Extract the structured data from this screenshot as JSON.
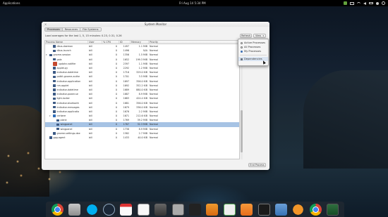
{
  "top_panel": {
    "applications_label": "Applications",
    "clock": "Fri Aug 14  5:34 PM"
  },
  "window": {
    "title": "System Monitor",
    "close_glyph": "×",
    "tabs": [
      "Processes",
      "Resources",
      "File Systems"
    ],
    "load_average": "Load averages for the last 1, 5, 15 minutes: 0.23, 0.31, 0.26",
    "refresh_label": "Refresh",
    "view_label": "View",
    "end_process_label": "End Process",
    "columns": [
      "Process Name",
      "User",
      "% CPU",
      "ID",
      "Memory",
      "Priority"
    ],
    "rows": [
      {
        "name": "dbus-daemon",
        "user": "bill",
        "cpu": "0",
        "id": "1497",
        "mem": "1.1 MiB",
        "pri": "Normal",
        "indent": 1,
        "icon": "gray",
        "exp": ""
      },
      {
        "name": "dbus-launch",
        "user": "bill",
        "cpu": "0",
        "id": "1496",
        "mem": "N/A",
        "pri": "Normal",
        "indent": 1,
        "icon": "gray",
        "exp": ""
      },
      {
        "name": "gnome-session",
        "user": "bill",
        "cpu": "0",
        "id": "1356",
        "mem": "1.5 MiB",
        "pri": "Normal",
        "indent": 0,
        "icon": "gray",
        "exp": "▾"
      },
      {
        "name": "gala",
        "user": "bill",
        "cpu": "0",
        "id": "1652",
        "mem": "199.3 MiB",
        "pri": "Normal",
        "indent": 1,
        "icon": "gray",
        "exp": ""
      },
      {
        "name": "update-notifier",
        "user": "bill",
        "cpu": "0",
        "id": "2397",
        "mem": "1.1 MiB",
        "pri": "Normal",
        "indent": 1,
        "icon": "big",
        "exp": ""
      },
      {
        "name": "applet.py",
        "user": "bill",
        "cpu": "0",
        "id": "2292",
        "mem": "1.2 MiB",
        "pri": "Normal",
        "indent": 1,
        "icon": "gray",
        "exp": ""
      },
      {
        "name": "indicator-datetime",
        "user": "bill",
        "cpu": "0",
        "id": "1716",
        "mem": "329.0 KiB",
        "pri": "Normal",
        "indent": 1,
        "icon": "gray",
        "exp": ""
      },
      {
        "name": "polkit-gnome-authe",
        "user": "bill",
        "cpu": "0",
        "id": "1701",
        "mem": "3.5 MiB",
        "pri": "Normal",
        "indent": 1,
        "icon": "gray",
        "exp": ""
      },
      {
        "name": "indicator-application",
        "user": "bill",
        "cpu": "0",
        "id": "1697",
        "mem": "356.0 KiB",
        "pri": "Normal",
        "indent": 1,
        "icon": "gray",
        "exp": ""
      },
      {
        "name": "nm-applet",
        "user": "bill",
        "cpu": "0",
        "id": "1692",
        "mem": "352.2 KiB",
        "pri": "Normal",
        "indent": 1,
        "icon": "gray",
        "exp": ""
      },
      {
        "name": "indicator-datetime",
        "user": "bill",
        "cpu": "0",
        "id": "1689",
        "mem": "880.0 KiB",
        "pri": "Normal",
        "indent": 1,
        "icon": "gray",
        "exp": ""
      },
      {
        "name": "indicator-power-se",
        "user": "bill",
        "cpu": "0",
        "id": "1687",
        "mem": "8.9 MiB",
        "pri": "Normal",
        "indent": 1,
        "icon": "gray",
        "exp": ""
      },
      {
        "name": "light-locker",
        "user": "bill",
        "cpu": "0",
        "id": "1683",
        "mem": "424.4 KiB",
        "pri": "Normal",
        "indent": 1,
        "icon": "gray",
        "exp": ""
      },
      {
        "name": "indicator-bluetooth",
        "user": "bill",
        "cpu": "0",
        "id": "1681",
        "mem": "356.0 KiB",
        "pri": "Normal",
        "indent": 1,
        "icon": "gray",
        "exp": ""
      },
      {
        "name": "indicator-messages",
        "user": "bill",
        "cpu": "0",
        "id": "1679",
        "mem": "336.0 KiB",
        "pri": "Normal",
        "indent": 1,
        "icon": "gray",
        "exp": ""
      },
      {
        "name": "indicator-applicatio",
        "user": "bill",
        "cpu": "0",
        "id": "1676",
        "mem": "2.2 MiB",
        "pri": "Normal",
        "indent": 1,
        "icon": "gray",
        "exp": ""
      },
      {
        "name": "cerbere",
        "user": "bill",
        "cpu": "0",
        "id": "1671",
        "mem": "212.6 KiB",
        "pri": "Normal",
        "indent": 1,
        "icon": "blue",
        "exp": "▾"
      },
      {
        "name": "plank",
        "user": "bill",
        "cpu": "0",
        "id": "1769",
        "mem": "39.2 MiB",
        "pri": "Normal",
        "indent": 2,
        "icon": "gray",
        "exp": ""
      },
      {
        "name": "wingpanel",
        "user": "bill",
        "cpu": "0",
        "id": "1767",
        "mem": "32.3 MiB",
        "pri": "Normal",
        "indent": 2,
        "icon": "gray",
        "exp": "",
        "selected": true
      },
      {
        "name": "wingpanel",
        "user": "bill",
        "cpu": "0",
        "id": "1738",
        "mem": "8.9 MiB",
        "pri": "Normal",
        "indent": 2,
        "icon": "gray",
        "exp": ""
      },
      {
        "name": "gnome-settings-dae",
        "user": "bill",
        "cpu": "0",
        "id": "1582",
        "mem": "2.7 MiB",
        "pri": "Normal",
        "indent": 1,
        "icon": "gray",
        "exp": ""
      },
      {
        "name": "gpg-agent",
        "user": "bill",
        "cpu": "0",
        "id": "1433",
        "mem": "40.0 KiB",
        "pri": "Normal",
        "indent": 0,
        "icon": "gray",
        "exp": ""
      }
    ]
  },
  "view_menu": {
    "items": [
      {
        "label": "Active Processes",
        "kind": "radio",
        "on": false
      },
      {
        "label": "All Processes",
        "kind": "radio",
        "on": false
      },
      {
        "label": "My Processes",
        "kind": "radio",
        "on": true
      }
    ],
    "dependencies": {
      "label": "Dependencies",
      "checked": true
    }
  },
  "dock": {
    "icons": [
      "chrome-icon",
      "folder-icon",
      "skype-icon",
      "steam-icon",
      "calendar-icon",
      "text-editor-icon",
      "monitor-icon",
      "files-icon",
      "video-icon",
      "music-icon",
      "spreadsheet-icon",
      "software-center-icon",
      "terminal-icon",
      "switchboard-icon",
      "update-icon",
      "chrome-icon",
      "system-monitor-icon"
    ]
  }
}
